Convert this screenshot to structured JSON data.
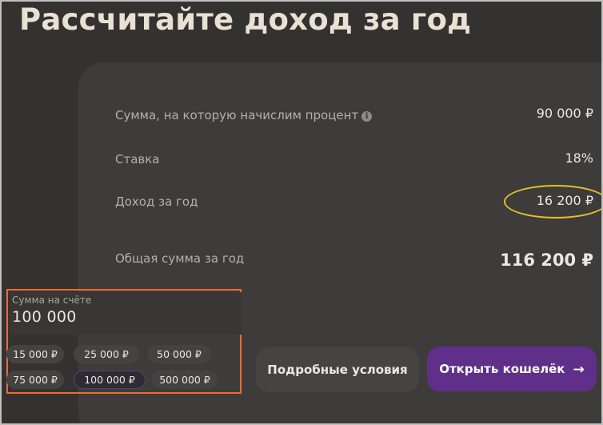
{
  "title": "Рассчитайте доход за год",
  "rows": [
    {
      "label": "Сумма, на которую начислим процент",
      "value": "90 000 ₽"
    },
    {
      "label": "Ставка",
      "value": "18%"
    },
    {
      "label": "Доход за год",
      "value": "16 200 ₽"
    },
    {
      "label": "Общая сумма за год",
      "value": "116 200 ₽"
    }
  ],
  "icons": {
    "info": "info-icon",
    "arrow": "arrow-right-icon"
  },
  "info_glyph": "i",
  "balance": {
    "label": "Сумма на счёте",
    "value": "100 000"
  },
  "presets": [
    "15 000 ₽",
    "25 000 ₽",
    "50 000 ₽",
    "75 000 ₽",
    "100 000 ₽",
    "500 000 ₽"
  ],
  "selected_preset": "100 000 ₽",
  "buttons": {
    "details": "Подробные условия",
    "open": "Открыть кошелёк",
    "open_arrow": "→"
  },
  "colors": {
    "background": "#333231",
    "card": "#3d3c3a",
    "accent_purple": "#5f2f8a",
    "highlight_ellipse": "#e7be2a",
    "highlight_box": "#f06a3a"
  }
}
